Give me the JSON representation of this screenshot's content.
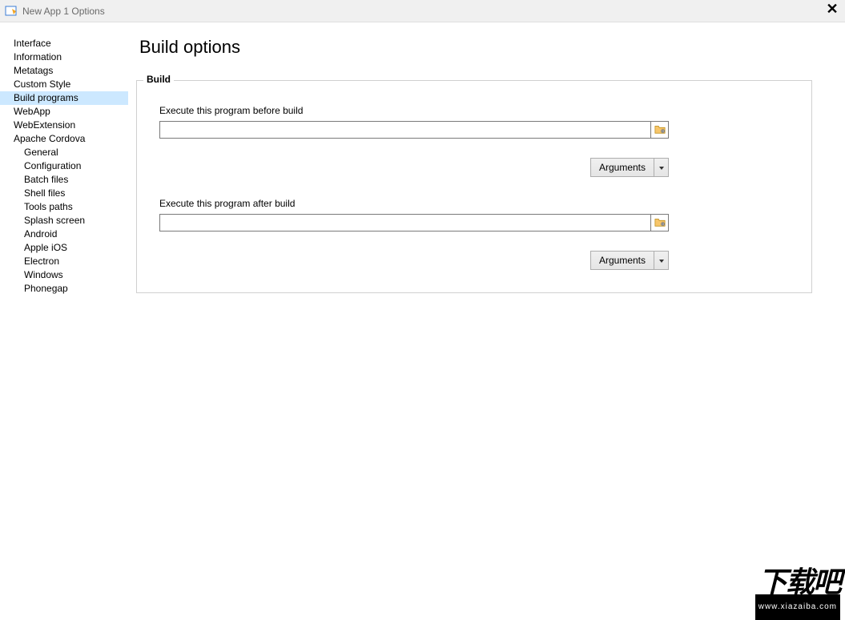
{
  "window": {
    "title": "New App 1 Options"
  },
  "sidebar": {
    "items": [
      {
        "label": "Interface",
        "type": "item",
        "selected": false
      },
      {
        "label": "Information",
        "type": "item",
        "selected": false
      },
      {
        "label": "Metatags",
        "type": "item",
        "selected": false
      },
      {
        "label": "Custom Style",
        "type": "item",
        "selected": false
      },
      {
        "label": "Build programs",
        "type": "item",
        "selected": true
      },
      {
        "label": "WebApp",
        "type": "item",
        "selected": false
      },
      {
        "label": "WebExtension",
        "type": "item",
        "selected": false
      },
      {
        "label": "Apache Cordova",
        "type": "item",
        "selected": false
      },
      {
        "label": "General",
        "type": "subitem",
        "selected": false
      },
      {
        "label": "Configuration",
        "type": "subitem",
        "selected": false
      },
      {
        "label": "Batch files",
        "type": "subitem",
        "selected": false
      },
      {
        "label": "Shell files",
        "type": "subitem",
        "selected": false
      },
      {
        "label": "Tools paths",
        "type": "subitem",
        "selected": false
      },
      {
        "label": "Splash screen",
        "type": "subitem",
        "selected": false
      },
      {
        "label": "Android",
        "type": "subitem",
        "selected": false
      },
      {
        "label": "Apple iOS",
        "type": "subitem",
        "selected": false
      },
      {
        "label": "Electron",
        "type": "subitem",
        "selected": false
      },
      {
        "label": "Windows",
        "type": "subitem",
        "selected": false
      },
      {
        "label": "Phonegap",
        "type": "subitem",
        "selected": false
      }
    ]
  },
  "main": {
    "page_title": "Build options",
    "group_legend": "Build",
    "before_label": "Execute this program before build",
    "before_value": "",
    "after_label": "Execute this program after build",
    "after_value": "",
    "arguments_label": "Arguments"
  },
  "watermark": {
    "text": "下载吧",
    "sub": "www.xiazaiba.com"
  }
}
